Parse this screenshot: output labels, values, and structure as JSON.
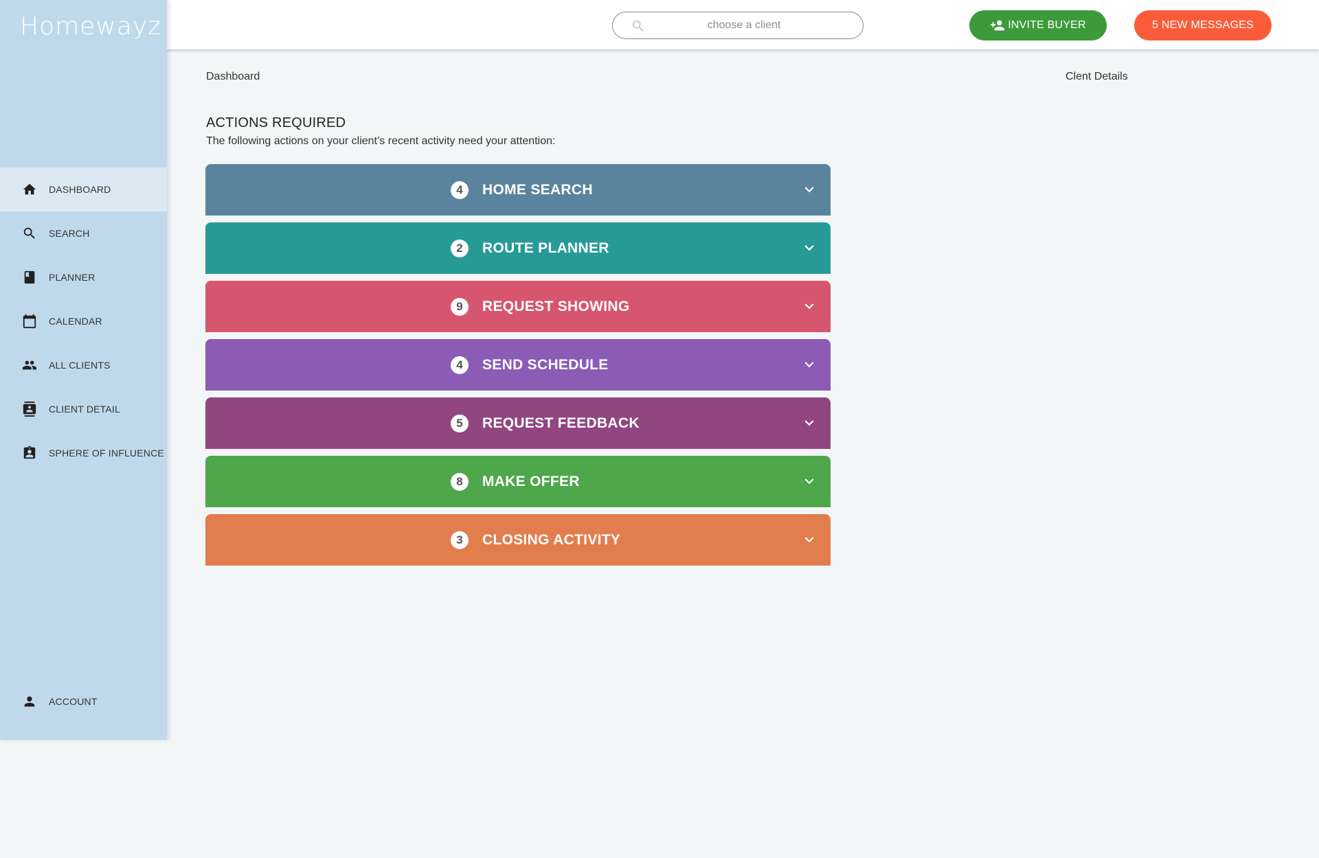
{
  "app": {
    "brand": "Homewayz"
  },
  "header": {
    "search_placeholder": "choose a client",
    "invite_label": "INVITE BUYER",
    "messages_label": "5 NEW MESSAGES"
  },
  "sidebar": {
    "items": [
      {
        "label": "DASHBOARD",
        "icon": "home-icon",
        "active": true
      },
      {
        "label": "SEARCH",
        "icon": "search-icon",
        "active": false
      },
      {
        "label": "PLANNER",
        "icon": "book-icon",
        "active": false
      },
      {
        "label": "CALENDAR",
        "icon": "calendar-icon",
        "active": false
      },
      {
        "label": "ALL CLIENTS",
        "icon": "people-icon",
        "active": false
      },
      {
        "label": "CLIENT DETAIL",
        "icon": "contact-card-icon",
        "active": false
      },
      {
        "label": "SPHERE OF INFLUENCE",
        "icon": "badge-icon",
        "active": false
      }
    ],
    "account_label": "ACCOUNT"
  },
  "main": {
    "breadcrumb": "Dashboard",
    "client_details": "Clent Details",
    "title": "ACTIONS REQUIRED",
    "subtitle": "The following actions on your client’s recent activity need your attention:",
    "actions": [
      {
        "count": "4",
        "label": "HOME SEARCH",
        "color": "#5a849e"
      },
      {
        "count": "2",
        "label": "ROUTE PLANNER",
        "color": "#269b96"
      },
      {
        "count": "9",
        "label": "REQUEST SHOWING",
        "color": "#d6566f"
      },
      {
        "count": "4",
        "label": "SEND SCHEDULE",
        "color": "#8b5bb6"
      },
      {
        "count": "5",
        "label": "REQUEST FEEDBACK",
        "color": "#914680"
      },
      {
        "count": "8",
        "label": "MAKE OFFER",
        "color": "#4ea74a"
      },
      {
        "count": "3",
        "label": "CLOSING ACTIVITY",
        "color": "#e27d4d"
      }
    ]
  }
}
